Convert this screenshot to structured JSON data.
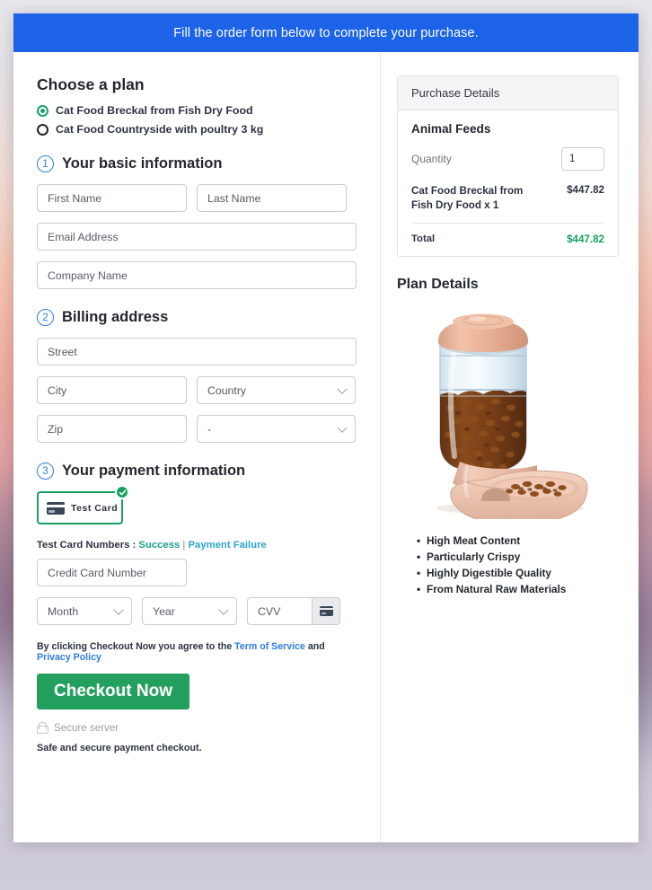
{
  "banner": {
    "text": "Fill the order form below to complete your purchase."
  },
  "plan": {
    "title": "Choose a plan",
    "options": [
      {
        "label": "Cat Food Breckal from Fish Dry Food",
        "selected": true
      },
      {
        "label": "Cat Food Countryside with poultry 3 kg",
        "selected": false
      }
    ]
  },
  "steps": {
    "basic": {
      "num": "1",
      "title": "Your basic information"
    },
    "billing": {
      "num": "2",
      "title": "Billing address"
    },
    "payment": {
      "num": "3",
      "title": "Your payment information"
    }
  },
  "fields": {
    "first_name": "First Name",
    "last_name": "Last Name",
    "email": "Email Address",
    "company": "Company Name",
    "street": "Street",
    "city": "City",
    "country": "Country",
    "zip": "Zip",
    "state": "-",
    "credit_card": "Credit Card Number",
    "month": "Month",
    "year": "Year",
    "cvv": "CVV"
  },
  "payment": {
    "tile_label": "Test Card",
    "test_prefix": "Test Card Numbers :",
    "test_success": "Success",
    "test_separator": "|",
    "test_failure": "Payment Failure"
  },
  "agreement": {
    "prefix": "By clicking Checkout Now you agree to the",
    "terms": "Term of Service",
    "and": "and",
    "privacy": "Privacy Policy"
  },
  "checkout": {
    "label": "Checkout Now"
  },
  "footer": {
    "secure_server": "Secure server",
    "safe_text": "Safe and secure payment checkout."
  },
  "purchase": {
    "header": "Purchase Details",
    "group_title": "Animal Feeds",
    "quantity_label": "Quantity",
    "quantity_value": "1",
    "item_name": "Cat Food Breckal from Fish Dry Food x 1",
    "item_price": "$447.82",
    "total_label": "Total",
    "total_value": "$447.82"
  },
  "plan_details": {
    "title": "Plan Details",
    "features": [
      "High Meat Content",
      "Particularly Crispy",
      "Highly Digestible Quality",
      "From Natural Raw Materials"
    ]
  },
  "colors": {
    "banner_blue": "#1c63e7",
    "accent_green": "#17a05f",
    "step_blue": "#2f7ce0",
    "link_blue": "#2f7ce0"
  }
}
